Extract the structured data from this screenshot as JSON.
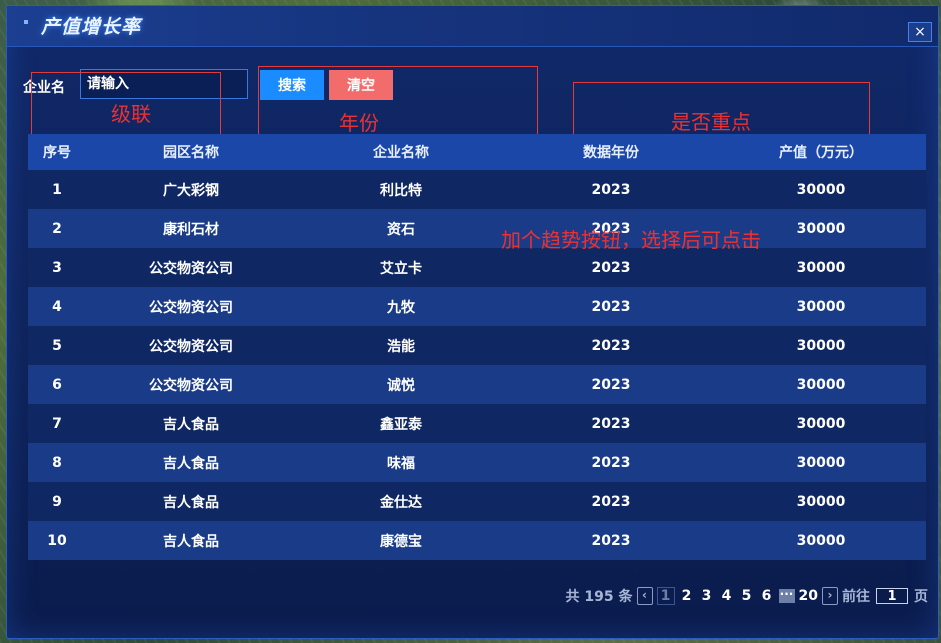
{
  "window": {
    "title": "产值增长率",
    "close_label": "×"
  },
  "search": {
    "label": "企业名",
    "placeholder": "请输入",
    "search_label": "搜索",
    "clear_label": "清空"
  },
  "annotations": {
    "cascade": "级联",
    "year": "年份",
    "key": "是否重点",
    "trend": "加个趋势按钮，选择后可点击"
  },
  "table": {
    "headers": [
      "序号",
      "园区名称",
      "企业名称",
      "数据年份",
      "产值（万元）"
    ],
    "rows": [
      [
        "1",
        "广大彩钢",
        "利比特",
        "2023",
        "30000"
      ],
      [
        "2",
        "康利石材",
        "资石",
        "2023",
        "30000"
      ],
      [
        "3",
        "公交物资公司",
        "艾立卡",
        "2023",
        "30000"
      ],
      [
        "4",
        "公交物资公司",
        "九牧",
        "2023",
        "30000"
      ],
      [
        "5",
        "公交物资公司",
        "浩能",
        "2023",
        "30000"
      ],
      [
        "6",
        "公交物资公司",
        "诚悦",
        "2023",
        "30000"
      ],
      [
        "7",
        "吉人食品",
        "鑫亚泰",
        "2023",
        "30000"
      ],
      [
        "8",
        "吉人食品",
        "味福",
        "2023",
        "30000"
      ],
      [
        "9",
        "吉人食品",
        "金仕达",
        "2023",
        "30000"
      ],
      [
        "10",
        "吉人食品",
        "康德宝",
        "2023",
        "30000"
      ]
    ]
  },
  "pager": {
    "total_text": "共 195 条",
    "prev_icon": "‹",
    "next_icon": "›",
    "pages": [
      "1",
      "2",
      "3",
      "4",
      "5",
      "6"
    ],
    "current": "1",
    "more": "···",
    "last": "20",
    "goto_label": "前往",
    "goto_value": "1",
    "page_unit": "页"
  }
}
